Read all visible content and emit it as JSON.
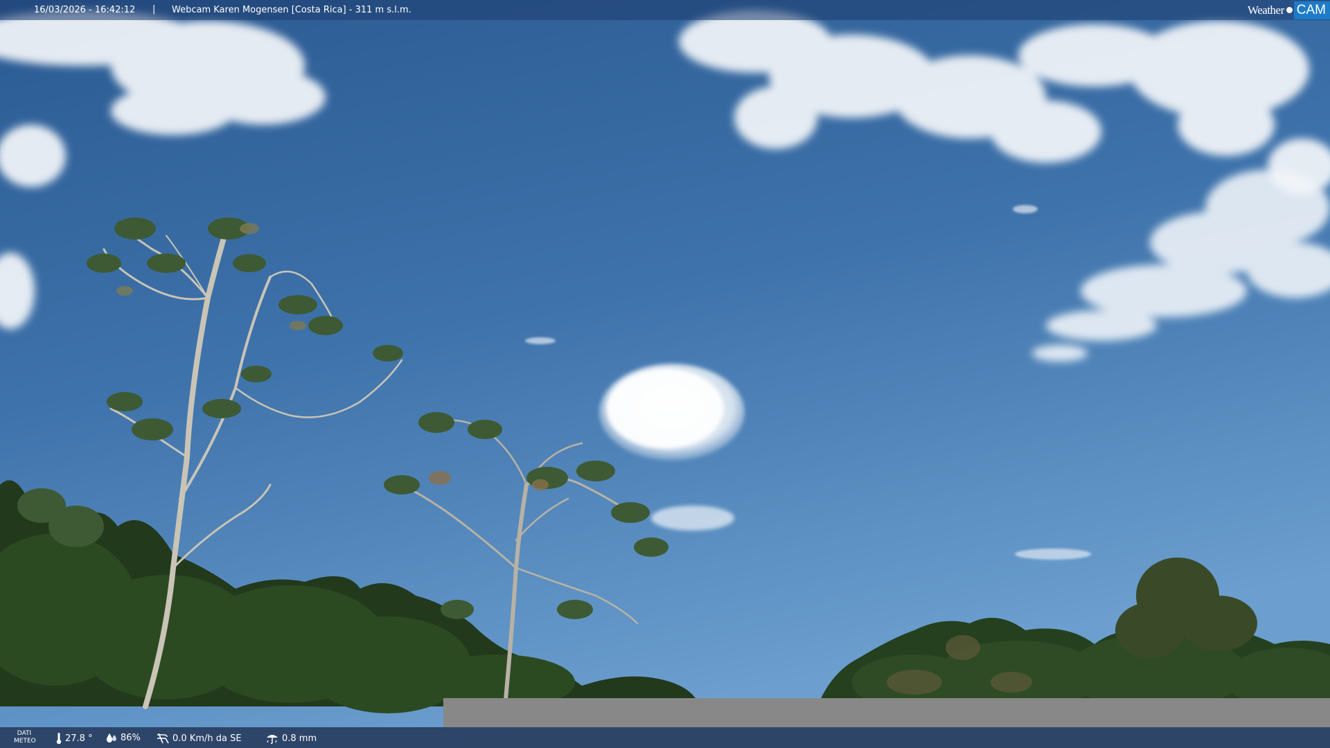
{
  "overlay": {
    "timestamp": "16/03/2026 - 16:42:12",
    "separator": "|",
    "location": "Webcam Karen Mogensen [Costa Rica]  - 311 m s.l.m."
  },
  "brand": {
    "weather": "Weather",
    "cam": "CAM"
  },
  "meteo": {
    "label_line1": "DATI",
    "label_line2": "METEO",
    "temperature": "27.8 °",
    "humidity": "86%",
    "wind": "0.0 Km/h da SE",
    "rain": "0.8 mm",
    "icons": [
      "thermometer-icon",
      "humidity-icon",
      "wind-icon",
      "rain-icon"
    ]
  },
  "colors": {
    "sky_top": "#2f5f97",
    "sky_bottom": "#6a9ccc",
    "foliage": "#27431f",
    "brand_accent": "#1d7cc8"
  }
}
